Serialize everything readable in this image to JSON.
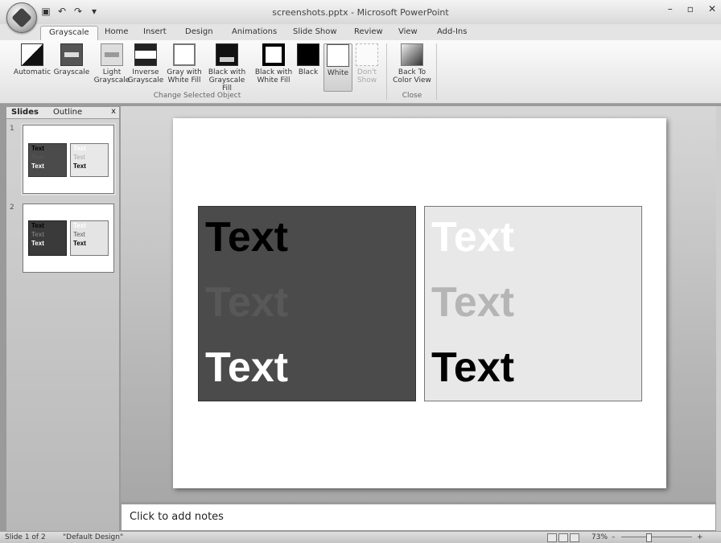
{
  "window": {
    "title": "screenshots.pptx - Microsoft PowerPoint",
    "minimize": "–",
    "maximize": "▫",
    "close": "✕"
  },
  "qat": {
    "save_icon": "save-icon",
    "undo_icon": "undo-icon",
    "redo_icon": "redo-icon",
    "customize_icon": "dropdown-icon"
  },
  "tabs": [
    "Grayscale",
    "Home",
    "Insert",
    "Design",
    "Animations",
    "Slide Show",
    "Review",
    "View",
    "Add-Ins"
  ],
  "ribbon": {
    "buttons": [
      {
        "line1": "Automatic",
        "line2": ""
      },
      {
        "line1": "Grayscale",
        "line2": ""
      },
      {
        "line1": "Light",
        "line2": "Grayscale"
      },
      {
        "line1": "Inverse",
        "line2": "Grayscale"
      },
      {
        "line1": "Gray with",
        "line2": "White Fill"
      },
      {
        "line1": "Black with",
        "line2": "Grayscale Fill"
      },
      {
        "line1": "Black with",
        "line2": "White Fill"
      },
      {
        "line1": "Black",
        "line2": ""
      },
      {
        "line1": "White",
        "line2": ""
      },
      {
        "line1": "Don't",
        "line2": "Show"
      }
    ],
    "group_label": "Change Selected Object",
    "back": {
      "line1": "Back To",
      "line2": "Color View"
    },
    "close_group_label": "Close"
  },
  "panel": {
    "tab_slides": "Slides",
    "tab_outline": "Outline",
    "close": "x",
    "thumbs": [
      {
        "num": "1",
        "label": "Text"
      },
      {
        "num": "2",
        "label": "Text"
      }
    ]
  },
  "slide": {
    "dark_box": [
      "Text",
      "Text",
      "Text"
    ],
    "light_box": [
      "Text",
      "Text",
      "Text"
    ]
  },
  "notes": {
    "placeholder": "Click to add notes"
  },
  "status": {
    "slide_info": "Slide 1 of 2",
    "theme": "\"Default Design\"",
    "zoom": "73%",
    "zoom_out": "–",
    "zoom_in": "+"
  }
}
